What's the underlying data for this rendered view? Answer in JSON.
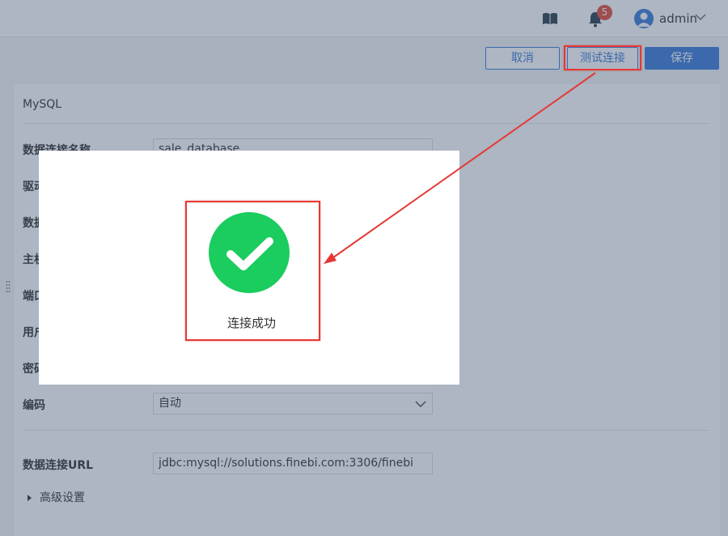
{
  "header": {
    "username": "admin",
    "notification_count": "5",
    "icons": {
      "guide": "book-icon",
      "notifications": "bell-icon",
      "user": "user-avatar-icon",
      "menu": "chevron-down-icon"
    }
  },
  "toolbar": {
    "cancel_label": "取消",
    "test_label": "测试连接",
    "save_label": "保存"
  },
  "form": {
    "db_type": "MySQL",
    "fields": [
      {
        "label": "数据连接名称",
        "value": "sale_database"
      },
      {
        "label": "驱动",
        "value": ""
      },
      {
        "label": "数据",
        "value": ""
      },
      {
        "label": "主机",
        "value": ""
      },
      {
        "label": "端口",
        "value": ""
      },
      {
        "label": "用户",
        "value": ""
      },
      {
        "label": "密码",
        "value": ""
      }
    ],
    "encoding": {
      "label": "编码",
      "value": "自动"
    },
    "url": {
      "label": "数据连接URL",
      "value": "jdbc:mysql://solutions.finebi.com:3306/finebi"
    },
    "advanced_label": "高级设置"
  },
  "modal": {
    "message": "连接成功",
    "icon": "check-circle-icon"
  },
  "colors": {
    "primary": "#3d7bd9",
    "success": "#1bcc5e",
    "highlight": "#e53935",
    "badge": "#e74c3c"
  }
}
